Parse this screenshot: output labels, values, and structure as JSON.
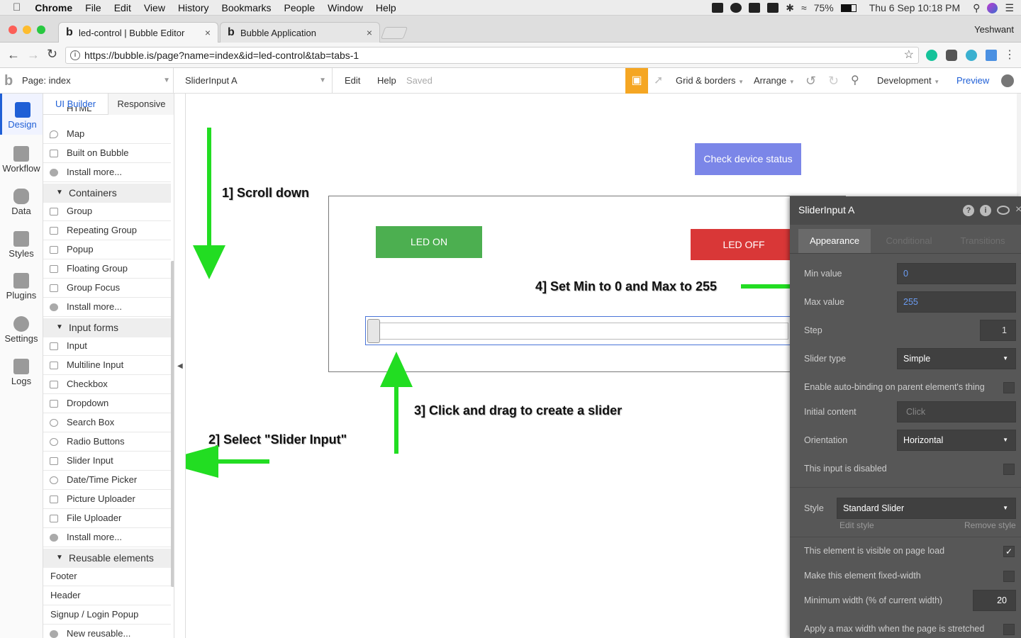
{
  "menubar": {
    "app": "Chrome",
    "items": [
      "File",
      "Edit",
      "View",
      "History",
      "Bookmarks",
      "People",
      "Window",
      "Help"
    ],
    "battery": "75%",
    "datetime": "Thu 6 Sep  10:18 PM"
  },
  "browser": {
    "tabs": [
      {
        "title": "led-control | Bubble Editor",
        "active": true
      },
      {
        "title": "Bubble Application",
        "active": false
      }
    ],
    "profile": "Yeshwant",
    "url": "https://bubble.is/page?name=index&id=led-control&tab=tabs-1"
  },
  "toolbar": {
    "page_label": "Page: index",
    "element_select": "SliderInput A",
    "edit": "Edit",
    "help": "Help",
    "saved": "Saved",
    "grid": "Grid & borders",
    "arrange": "Arrange",
    "env": "Development",
    "preview": "Preview"
  },
  "rail": [
    "Design",
    "Workflow",
    "Data",
    "Styles",
    "Plugins",
    "Settings",
    "Logs"
  ],
  "panel": {
    "tabs": [
      "UI Builder",
      "Responsive"
    ],
    "truncated_top": "HTML",
    "rows_top": [
      "Map",
      "Built on Bubble",
      "Install more..."
    ],
    "containers_header": "Containers",
    "containers": [
      "Group",
      "Repeating Group",
      "Popup",
      "Floating Group",
      "Group Focus",
      "Install more..."
    ],
    "inputs_header": "Input forms",
    "inputs": [
      "Input",
      "Multiline Input",
      "Checkbox",
      "Dropdown",
      "Search Box",
      "Radio Buttons",
      "Slider Input",
      "Date/Time Picker",
      "Picture Uploader",
      "File Uploader",
      "Install more..."
    ],
    "reusable_header": "Reusable elements",
    "reusable": [
      "Footer",
      "Header",
      "Signup / Login Popup",
      "New reusable..."
    ]
  },
  "canvas": {
    "check_button": "Check device status",
    "led_on": "LED ON",
    "led_off": "LED OFF",
    "annotations": [
      "1] Scroll down",
      "2] Select \"Slider Input\"",
      "3] Click and drag to create a slider",
      "4] Set Min to 0 and Max to 255"
    ]
  },
  "editor": {
    "title": "SliderInput A",
    "tabs": [
      "Appearance",
      "Conditional",
      "Transitions"
    ],
    "min_label": "Min value",
    "min_value": "0",
    "max_label": "Max value",
    "max_value": "255",
    "step_label": "Step",
    "step_value": "1",
    "slider_type_label": "Slider type",
    "slider_type": "Simple",
    "autobinding_label": "Enable auto-binding on parent element's thing",
    "initial_label": "Initial content",
    "initial_placeholder": "Click",
    "orientation_label": "Orientation",
    "orientation": "Horizontal",
    "disabled_label": "This input is disabled",
    "style_label": "Style",
    "style_value": "Standard Slider",
    "edit_style": "Edit style",
    "remove_style": "Remove style",
    "visible_label": "This element is visible on page load",
    "fixed_width_label": "Make this element fixed-width",
    "min_width_label": "Minimum width (% of current width)",
    "min_width_value": "20",
    "max_width_label": "Apply a max width when the page is stretched"
  },
  "colors": {
    "led_on": "#4caf50",
    "led_off": "#d93737",
    "check_btn": "#7b86e8",
    "accent": "#1f5fd6",
    "arrow": "#22dd22"
  }
}
